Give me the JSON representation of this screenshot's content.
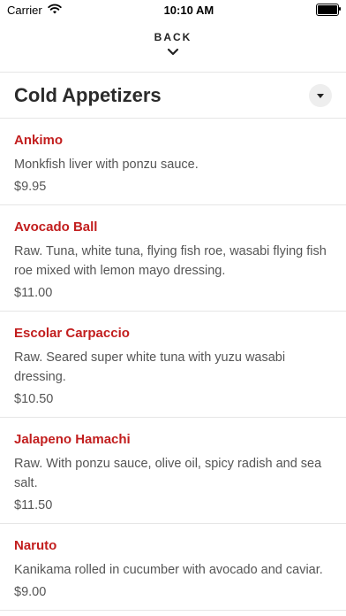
{
  "status": {
    "carrier": "Carrier",
    "time": "10:10 AM"
  },
  "nav": {
    "back_label": "BACK"
  },
  "section": {
    "title": "Cold Appetizers"
  },
  "items": [
    {
      "name": "Ankimo",
      "desc": "Monkfish liver with ponzu sauce.",
      "price": "$9.95"
    },
    {
      "name": "Avocado Ball",
      "desc": "Raw. Tuna, white tuna, flying fish roe, wasabi flying fish roe mixed with lemon mayo dressing.",
      "price": "$11.00"
    },
    {
      "name": "Escolar Carpaccio",
      "desc": "Raw. Seared super white tuna with yuzu wasabi dressing.",
      "price": "$10.50"
    },
    {
      "name": "Jalapeno Hamachi",
      "desc": "Raw. With ponzu sauce, olive oil, spicy radish and sea salt.",
      "price": "$11.50"
    },
    {
      "name": "Naruto",
      "desc": "Kanikama rolled in cucumber with avocado and caviar.",
      "price": "$9.00"
    }
  ],
  "colors": {
    "accent": "#c21e1e",
    "divider": "#e6e6e6"
  },
  "icons": [
    "wifi-icon",
    "battery-icon",
    "chevron-down-icon",
    "dropdown-caret-icon"
  ]
}
